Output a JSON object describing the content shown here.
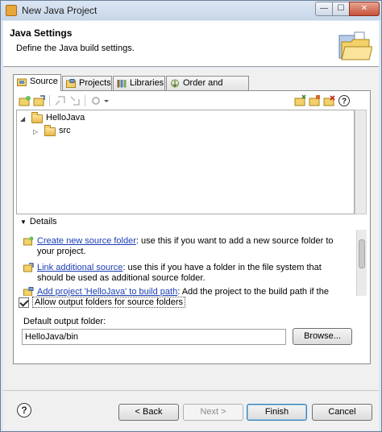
{
  "window": {
    "title": "New Java Project",
    "controls": {
      "minimize": "—",
      "maximize": "☐",
      "close": "✕"
    }
  },
  "header": {
    "title": "Java Settings",
    "description": "Define the Java build settings."
  },
  "tabs": [
    {
      "label": "Source",
      "icon": "source-icon",
      "active": true
    },
    {
      "label": "Projects",
      "icon": "projects-icon",
      "active": false
    },
    {
      "label": "Libraries",
      "icon": "libraries-icon",
      "active": false
    },
    {
      "label": "Order and Export",
      "icon": "order-export-icon",
      "active": false
    }
  ],
  "tree": {
    "root": {
      "label": "HelloJava",
      "expanded": true
    },
    "children": [
      {
        "label": "src",
        "expanded": false
      }
    ]
  },
  "details": {
    "label": "Details",
    "items": [
      {
        "link": "Create new source folder",
        "text": ": use this if you want to add a new source folder to your project."
      },
      {
        "link": "Link additional source",
        "text": ": use this if you have a folder in the file system that should be used as additional source folder."
      },
      {
        "link": "Add project 'HelloJava' to build path",
        "text": ": Add the project to the build path if the project"
      }
    ]
  },
  "allow_output_folders": {
    "label": "Allow output folders for source folders",
    "checked": true
  },
  "output": {
    "label": "Default output folder:",
    "value": "HelloJava/bin",
    "browse_label": "Browse..."
  },
  "footer": {
    "help": "?",
    "back_label": "< Back",
    "next_label": "Next >",
    "finish_label": "Finish",
    "cancel_label": "Cancel"
  },
  "colors": {
    "link": "#1a3eb4",
    "default_button_border": "#3c7fb1",
    "folder": "#e9b84c"
  }
}
